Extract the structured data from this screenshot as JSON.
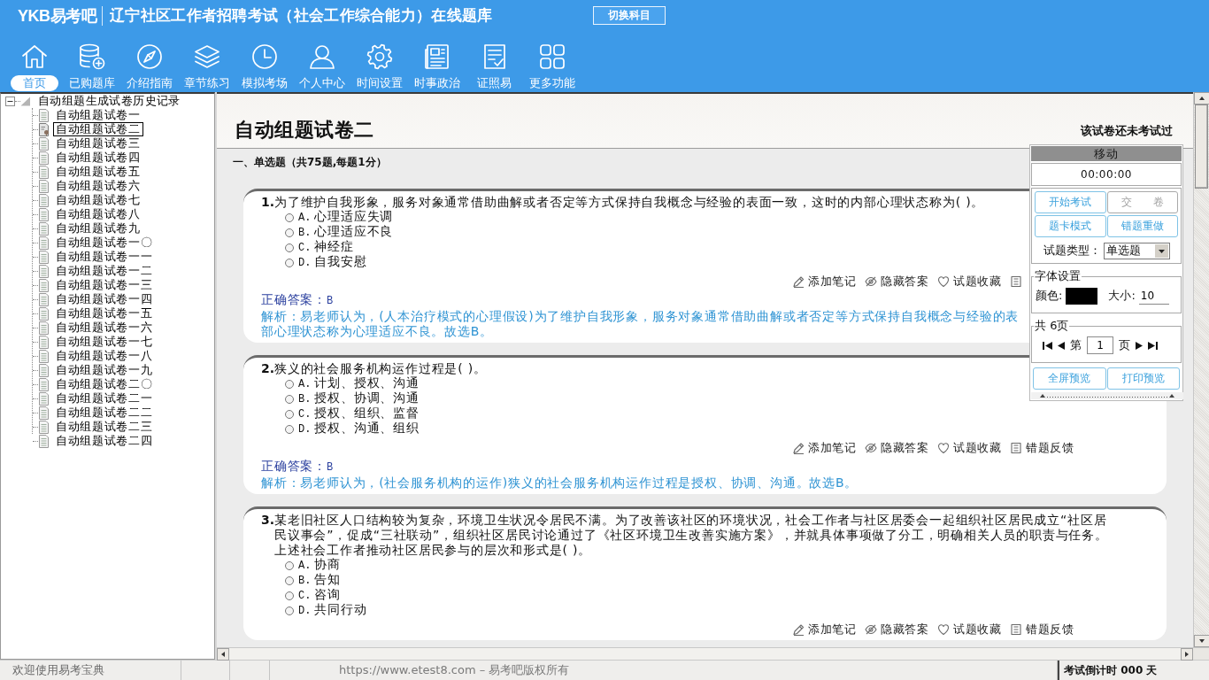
{
  "header": {
    "logo": "YKB易考吧",
    "title": "辽宁社区工作者招聘考试（社会工作综合能力）在线题库",
    "switch_button": "切换科目"
  },
  "toolbar": [
    {
      "kind": "home",
      "label": "首页",
      "selected": true
    },
    {
      "kind": "database",
      "label": "已购题库",
      "selected": false
    },
    {
      "kind": "compass",
      "label": "介绍指南",
      "selected": false
    },
    {
      "kind": "layers",
      "label": "章节练习",
      "selected": false
    },
    {
      "kind": "clock",
      "label": "模拟考场",
      "selected": false
    },
    {
      "kind": "user",
      "label": "个人中心",
      "selected": false
    },
    {
      "kind": "gear",
      "label": "时间设置",
      "selected": false
    },
    {
      "kind": "news",
      "label": "时事政治",
      "selected": false
    },
    {
      "kind": "checklist",
      "label": "证照易",
      "selected": false
    },
    {
      "kind": "grid",
      "label": "更多功能",
      "selected": false
    }
  ],
  "tree": {
    "label": "自动组题生成试卷历史记录",
    "expanded": true,
    "children": [
      {
        "label": "自动组题试卷一",
        "selected": false
      },
      {
        "label": "自动组题试卷二",
        "selected": true
      },
      {
        "label": "自动组题试卷三",
        "selected": false
      },
      {
        "label": "自动组题试卷四",
        "selected": false
      },
      {
        "label": "自动组题试卷五",
        "selected": false
      },
      {
        "label": "自动组题试卷六",
        "selected": false
      },
      {
        "label": "自动组题试卷七",
        "selected": false
      },
      {
        "label": "自动组题试卷八",
        "selected": false
      },
      {
        "label": "自动组题试卷九",
        "selected": false
      },
      {
        "label": "自动组题试卷一〇",
        "selected": false
      },
      {
        "label": "自动组题试卷一一",
        "selected": false
      },
      {
        "label": "自动组题试卷一二",
        "selected": false
      },
      {
        "label": "自动组题试卷一三",
        "selected": false
      },
      {
        "label": "自动组题试卷一四",
        "selected": false
      },
      {
        "label": "自动组题试卷一五",
        "selected": false
      },
      {
        "label": "自动组题试卷一六",
        "selected": false
      },
      {
        "label": "自动组题试卷一七",
        "selected": false
      },
      {
        "label": "自动组题试卷一八",
        "selected": false
      },
      {
        "label": "自动组题试卷一九",
        "selected": false
      },
      {
        "label": "自动组题试卷二〇",
        "selected": false
      },
      {
        "label": "自动组题试卷二一",
        "selected": false
      },
      {
        "label": "自动组题试卷二二",
        "selected": false
      },
      {
        "label": "自动组题试卷二三",
        "selected": false
      },
      {
        "label": "自动组题试卷二四",
        "selected": false
      }
    ]
  },
  "paper": {
    "title": "自动组题试卷二",
    "status": "该试卷还未考试过",
    "section": "一、单选题（共75题,每题1分）",
    "questions": [
      {
        "number": "1.",
        "stem": "为了维护自我形象，服务对象通常借助曲解或者否定等方式保持自我概念与经验的表面一致，这时的内部心理状态称为( )。",
        "options": [
          {
            "letter": "A.",
            "text": "心理适应失调",
            "selected": false
          },
          {
            "letter": "B.",
            "text": "心理适应不良",
            "selected": false
          },
          {
            "letter": "C.",
            "text": "神经症",
            "selected": false
          },
          {
            "letter": "D.",
            "text": "自我安慰",
            "selected": false
          }
        ],
        "actions": [
          {
            "kind": "note",
            "label": "添加笔记"
          },
          {
            "kind": "hide",
            "label": "隐藏答案"
          },
          {
            "kind": "favorite",
            "label": "试题收藏"
          },
          {
            "kind": "feedback"
          }
        ],
        "answer_label": "正确答案：",
        "answer": "B",
        "analysis": [
          "解析：易老师认为，(人本治疗模式的心理假设)为了维护自我形象，服务对象通常借助曲解或者否定等方式保持自我概念与经验的表",
          "部心理状态称为心理适应不良。故选B。"
        ]
      },
      {
        "number": "2.",
        "stem": "狭义的社会服务机构运作过程是( )。",
        "options": [
          {
            "letter": "A.",
            "text": "计划、授权、沟通",
            "selected": false
          },
          {
            "letter": "B.",
            "text": "授权、协调、沟通",
            "selected": false
          },
          {
            "letter": "C.",
            "text": "授权、组织、监督",
            "selected": false
          },
          {
            "letter": "D.",
            "text": "授权、沟通、组织",
            "selected": false
          }
        ],
        "actions": [
          {
            "kind": "note",
            "label": "添加笔记"
          },
          {
            "kind": "hide",
            "label": "隐藏答案"
          },
          {
            "kind": "favorite",
            "label": "试题收藏"
          },
          {
            "kind": "feedback",
            "label": "错题反馈"
          }
        ],
        "answer_label": "正确答案：",
        "answer": "B",
        "analysis": [
          "解析：易老师认为，(社会服务机构的运作)狭义的社会服务机构运作过程是授权、协调、沟通。故选B。"
        ]
      },
      {
        "number": "3.",
        "stem": "某老旧社区人口结构较为复杂，环境卫生状况令居民不满。为了改善该社区的环境状况，社会工作者与社区居委会一起组织社区居民成立“社区居民议事会”，促成“三社联动”，组织社区居民讨论通过了《社区环境卫生改善实施方案》，并就具体事项做了分工，明确相关人员的职责与任务。上述社会工作者推动社区居民参与的层次和形式是( )。",
        "options": [
          {
            "letter": "A.",
            "text": "协商",
            "selected": false
          },
          {
            "letter": "B.",
            "text": "告知",
            "selected": false
          },
          {
            "letter": "C.",
            "text": "咨询",
            "selected": false
          },
          {
            "letter": "D.",
            "text": "共同行动",
            "selected": false
          }
        ],
        "actions": [
          {
            "kind": "note",
            "label": "添加笔记"
          },
          {
            "kind": "hide",
            "label": "隐藏答案"
          },
          {
            "kind": "favorite",
            "label": "试题收藏"
          },
          {
            "kind": "feedback",
            "label": "错题反馈"
          }
        ]
      }
    ]
  },
  "panel": {
    "title": "移动",
    "timer": "00:00:00",
    "buttons": [
      {
        "label": "开始考试",
        "disabled": false
      },
      {
        "label": "交　　卷",
        "disabled": true
      },
      {
        "label": "题卡模式",
        "disabled": false
      },
      {
        "label": "错题重做",
        "disabled": false
      }
    ],
    "type_label": "试题类型：",
    "type_value": "单选题",
    "font_legend": "字体设置",
    "color_label": "颜色:",
    "size_label": "大小:",
    "size_value": "10",
    "page_legend": "共 6页",
    "page_prefix": "第",
    "page_value": "1",
    "page_suffix": "页",
    "preview_buttons": [
      "全屏预览",
      "打印预览"
    ]
  },
  "status_bar": {
    "welcome": "欢迎使用易考宝典",
    "copyright": "https://www.etest8.com – 易考吧版权所有",
    "countdown": "考试倒计时 000 天"
  }
}
